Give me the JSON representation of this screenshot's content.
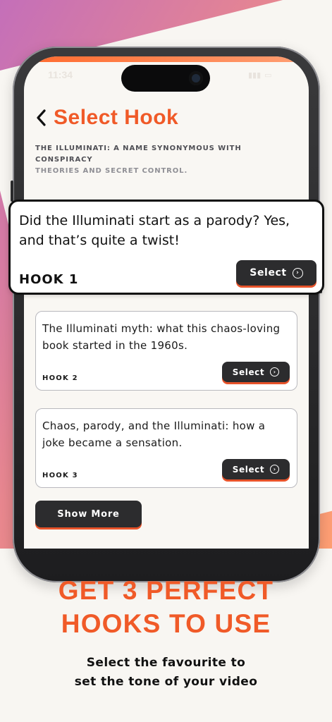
{
  "colors": {
    "accent": "#f05a28",
    "dark_button": "#2c2c2e",
    "card_border": "#b9b9be"
  },
  "status_bar": {
    "time": "11:34"
  },
  "header": {
    "back_icon": "chevron-left-icon",
    "title": "Select Hook",
    "subtitle_line1": "THE ILLUMINATI: A NAME SYNONYMOUS WITH CONSPIRACY",
    "subtitle_line2": "THEORIES AND SECRET CONTROL."
  },
  "hooks": [
    {
      "text": "Did the Illuminati start as a parody? Yes, and that’s quite a twist!",
      "label": "HOOK 1",
      "button_label": "Select"
    },
    {
      "text": "The Illuminati myth: what this chaos-loving book started in the 1960s.",
      "label": "HOOK 2",
      "button_label": "Select"
    },
    {
      "text": "Chaos, parody, and the Illuminati: how a joke became a sensation.",
      "label": "HOOK 3",
      "button_label": "Select"
    }
  ],
  "show_more_label": "Show More",
  "promo": {
    "title_line1": "GET 3 PERFECT",
    "title_line2": "HOOKS TO USE",
    "subtitle_line1": "Select the favourite to",
    "subtitle_line2": "set the tone of your video"
  }
}
